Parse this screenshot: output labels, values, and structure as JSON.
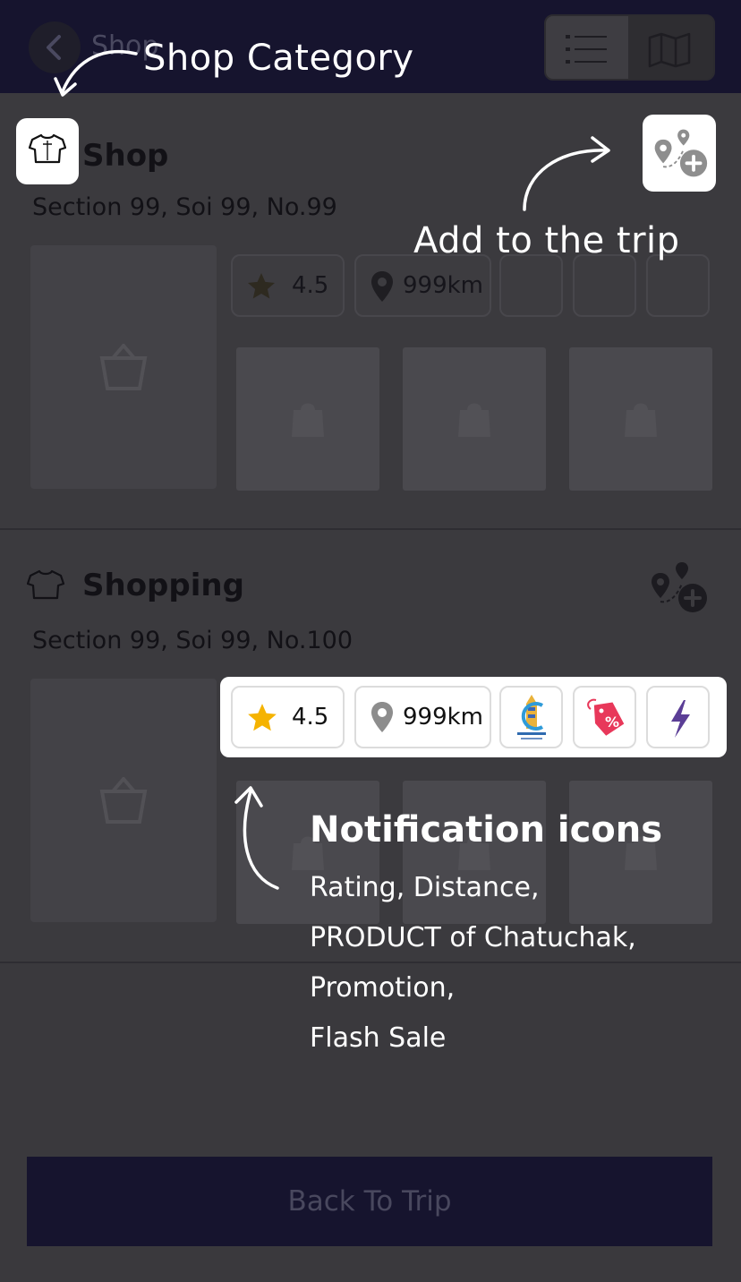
{
  "header": {
    "title": "Shop"
  },
  "shops": [
    {
      "name": "Shop",
      "address": "Section 99, Soi 99, No.99",
      "rating": "4.5",
      "distance": "999km"
    },
    {
      "name": "Shopping",
      "address": "Section 99, Soi 99, No.100",
      "rating": "4.5",
      "distance": "999km"
    }
  ],
  "footer": {
    "button_label": "Back To Trip"
  },
  "tutorial": {
    "shop_category": "Shop Category",
    "add_to_trip": "Add to the trip",
    "notification_title": "Notification icons",
    "notification_lines": [
      "Rating, Distance,",
      "PRODUCT of Chatuchak,",
      "Promotion,",
      "Flash Sale"
    ]
  },
  "colors": {
    "header_bg": "#16142e",
    "star": "#f5b301",
    "promo": "#e8385a",
    "flash": "#5b3e96"
  },
  "icons": [
    "back-chevron-icon",
    "list-view-icon",
    "map-view-icon",
    "shirt-category-icon",
    "add-to-trip-icon",
    "star-icon",
    "location-pin-icon",
    "chatuchak-product-icon",
    "promotion-tag-icon",
    "flash-sale-icon"
  ]
}
